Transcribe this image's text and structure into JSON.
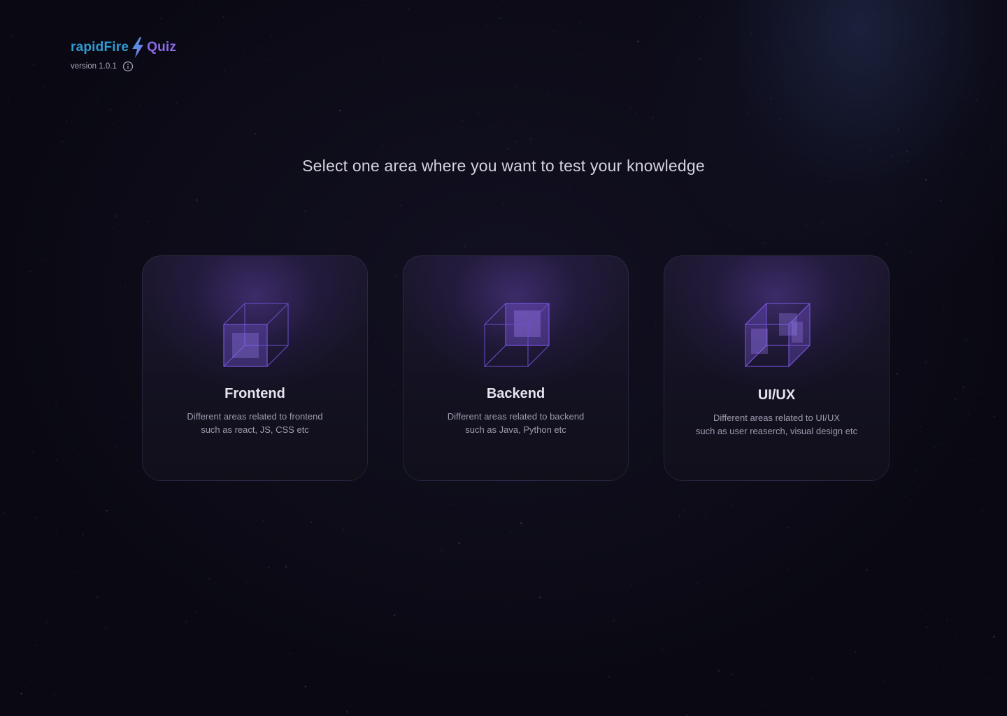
{
  "brand": {
    "name_part1": "rapidFire",
    "name_part2": "Quiz",
    "logo_colors": {
      "part1": "#2f9bd4",
      "part2": "#8d6ae8"
    },
    "bolt_icon": "lightning-bolt-icon"
  },
  "version": {
    "label": "version 1.0.1",
    "info_icon": "info-icon"
  },
  "headline": "Select one area where you want to test your knowledge",
  "cards": [
    {
      "title": "Frontend",
      "desc_line1": "Different areas related to frontend",
      "desc_line2": "such as react, JS, CSS etc",
      "icon": "cube-front-highlight-icon"
    },
    {
      "title": "Backend",
      "desc_line1": "Different areas related to backend",
      "desc_line2": "such as Java, Python etc",
      "icon": "cube-back-highlight-icon"
    },
    {
      "title": "UI/UX",
      "desc_line1": "Different areas related to UI/UX",
      "desc_line2": "such as user reaserch, visual design etc",
      "icon": "cube-sides-highlight-icon"
    }
  ],
  "colors": {
    "background": "#0a0913",
    "accent_purple": "#7a5bd6",
    "card_border": "#3a3450"
  }
}
